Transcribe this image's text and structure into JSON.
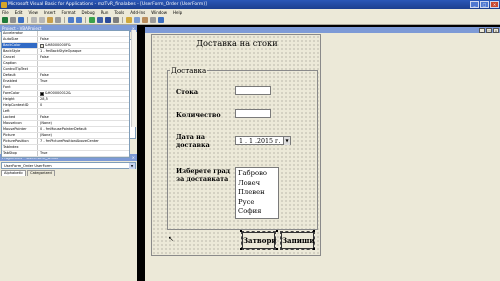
{
  "window": {
    "title": "Microsoft Visual Basic for Applications - mzTvR_finalabes - [UserForm_Order (UserForm)]"
  },
  "menu": [
    "File",
    "Edit",
    "View",
    "Insert",
    "Format",
    "Debug",
    "Run",
    "Tools",
    "Add-Ins",
    "Window",
    "Help"
  ],
  "project": {
    "header": "Project - VBAProject",
    "tree": [
      {
        "label": "VBAProject (mzTvR_finalabes)",
        "bold": true
      },
      {
        "label": "Microsoft Excel Objects"
      },
      {
        "label": "Sheet1 (Sheet1)"
      },
      {
        "label": "ThisWorkbook"
      },
      {
        "label": "Forms"
      },
      {
        "label": "UserForm_Order",
        "selected": true
      },
      {
        "label": "UserForm1"
      },
      {
        "label": "Modules"
      }
    ]
  },
  "properties": {
    "header": "Properties - UserForm_Order",
    "object": "UserForm_Order UserForm",
    "tabs": [
      "Alphabetic",
      "Categorized"
    ],
    "rows": [
      {
        "name": "Accelerator",
        "value": ""
      },
      {
        "name": "AutoSize",
        "value": "False"
      },
      {
        "name": "BackColor",
        "value": "&H8000000F&",
        "swatch": "#ece9d8",
        "selected": true
      },
      {
        "name": "BackStyle",
        "value": "1 - fmBackStyleOpaque"
      },
      {
        "name": "Cancel",
        "value": "False"
      },
      {
        "name": "Caption",
        "value": ""
      },
      {
        "name": "ControlTipText",
        "value": ""
      },
      {
        "name": "Default",
        "value": "False"
      },
      {
        "name": "Enabled",
        "value": "True"
      },
      {
        "name": "Font",
        "value": ""
      },
      {
        "name": "ForeColor",
        "value": "&H00000012&",
        "swatch": "#000000"
      },
      {
        "name": "Height",
        "value": "28,5"
      },
      {
        "name": "HelpContextID",
        "value": "0"
      },
      {
        "name": "Left",
        "value": ""
      },
      {
        "name": "Locked",
        "value": "False"
      },
      {
        "name": "MouseIcon",
        "value": "(None)"
      },
      {
        "name": "MousePointer",
        "value": "0 - fmMousePointerDefault"
      },
      {
        "name": "Picture",
        "value": "(None)"
      },
      {
        "name": "PicturePosition",
        "value": "7 - fmPicturePositionAboveCenter"
      },
      {
        "name": "TabIndex",
        "value": ""
      },
      {
        "name": "TabStop",
        "value": "True"
      }
    ]
  },
  "form": {
    "title": "Доставка на стоки",
    "frame_caption": "Доставка",
    "label_item": "Стока",
    "label_quantity": "Количество",
    "label_date": "Дата на доставка",
    "date_value": "1 . 1 .2015 г.",
    "label_warehouse": "Изберете град за доставката",
    "cities": [
      "Габрово",
      "Ловеч",
      "Плевен",
      "Русе",
      "София"
    ],
    "btn_close": "Затвори",
    "btn_save": "Запиши"
  },
  "colors": {
    "title_blue": "#2a57b8",
    "selection": "#316ac5",
    "form_bg": "#ece9d8"
  }
}
